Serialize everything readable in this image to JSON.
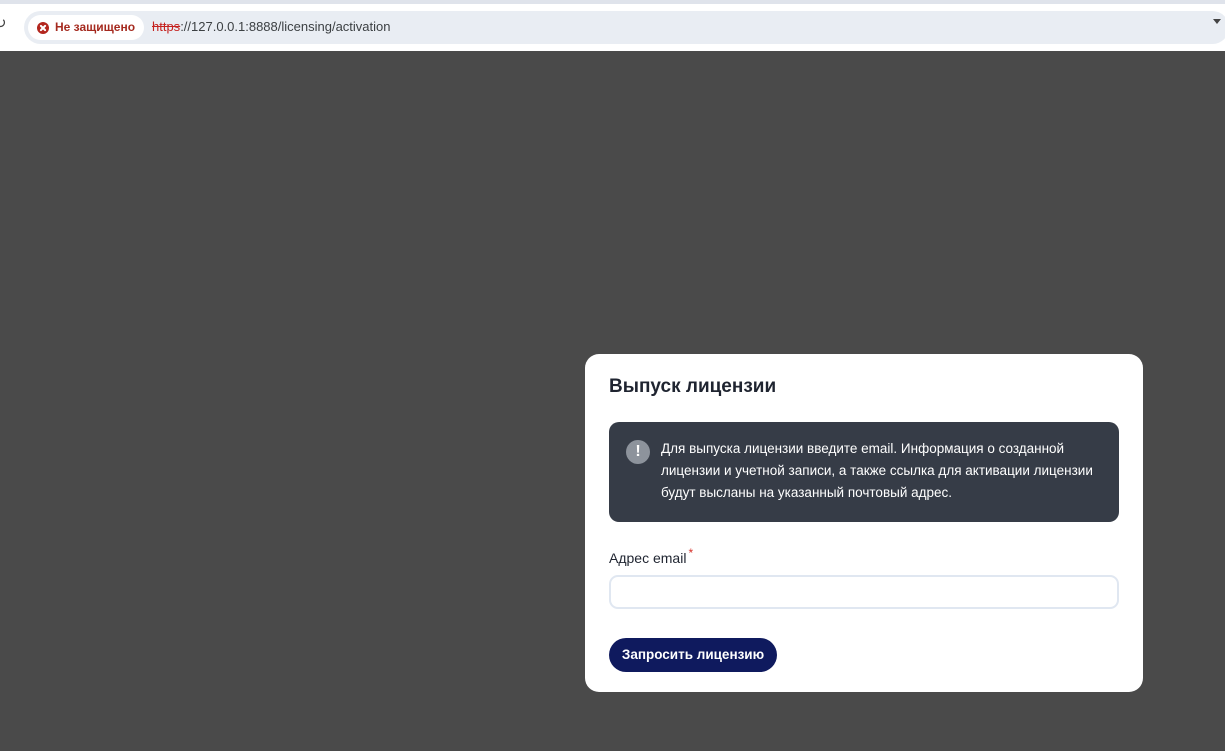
{
  "browser": {
    "security_label": "Не защищено",
    "url_scheme": "https",
    "url_rest": "://127.0.0.1:8888/licensing/activation"
  },
  "card": {
    "title": "Выпуск лицензии",
    "notice_text": "Для выпуска лицензии введите email. Информация о созданной лицензии и учетной записи, а также ссылка для активации лицензии будут высланы на указанный почтовый адрес.",
    "notice_icon_glyph": "!",
    "email_label": "Адрес email",
    "required_mark": "*",
    "email_value": "",
    "submit_label": "Запросить лицензию"
  },
  "colors": {
    "page_background": "#4a4a4a",
    "notice_background": "#363c47",
    "button_background": "#0f1a5e",
    "required_mark": "#d6312a",
    "insecure_red": "#c5221f"
  },
  "icons": {
    "reload": "reload-icon",
    "security": "error-circle-icon",
    "notice": "exclamation-circle-icon",
    "omnibox_menu": "chevron-down-icon"
  }
}
